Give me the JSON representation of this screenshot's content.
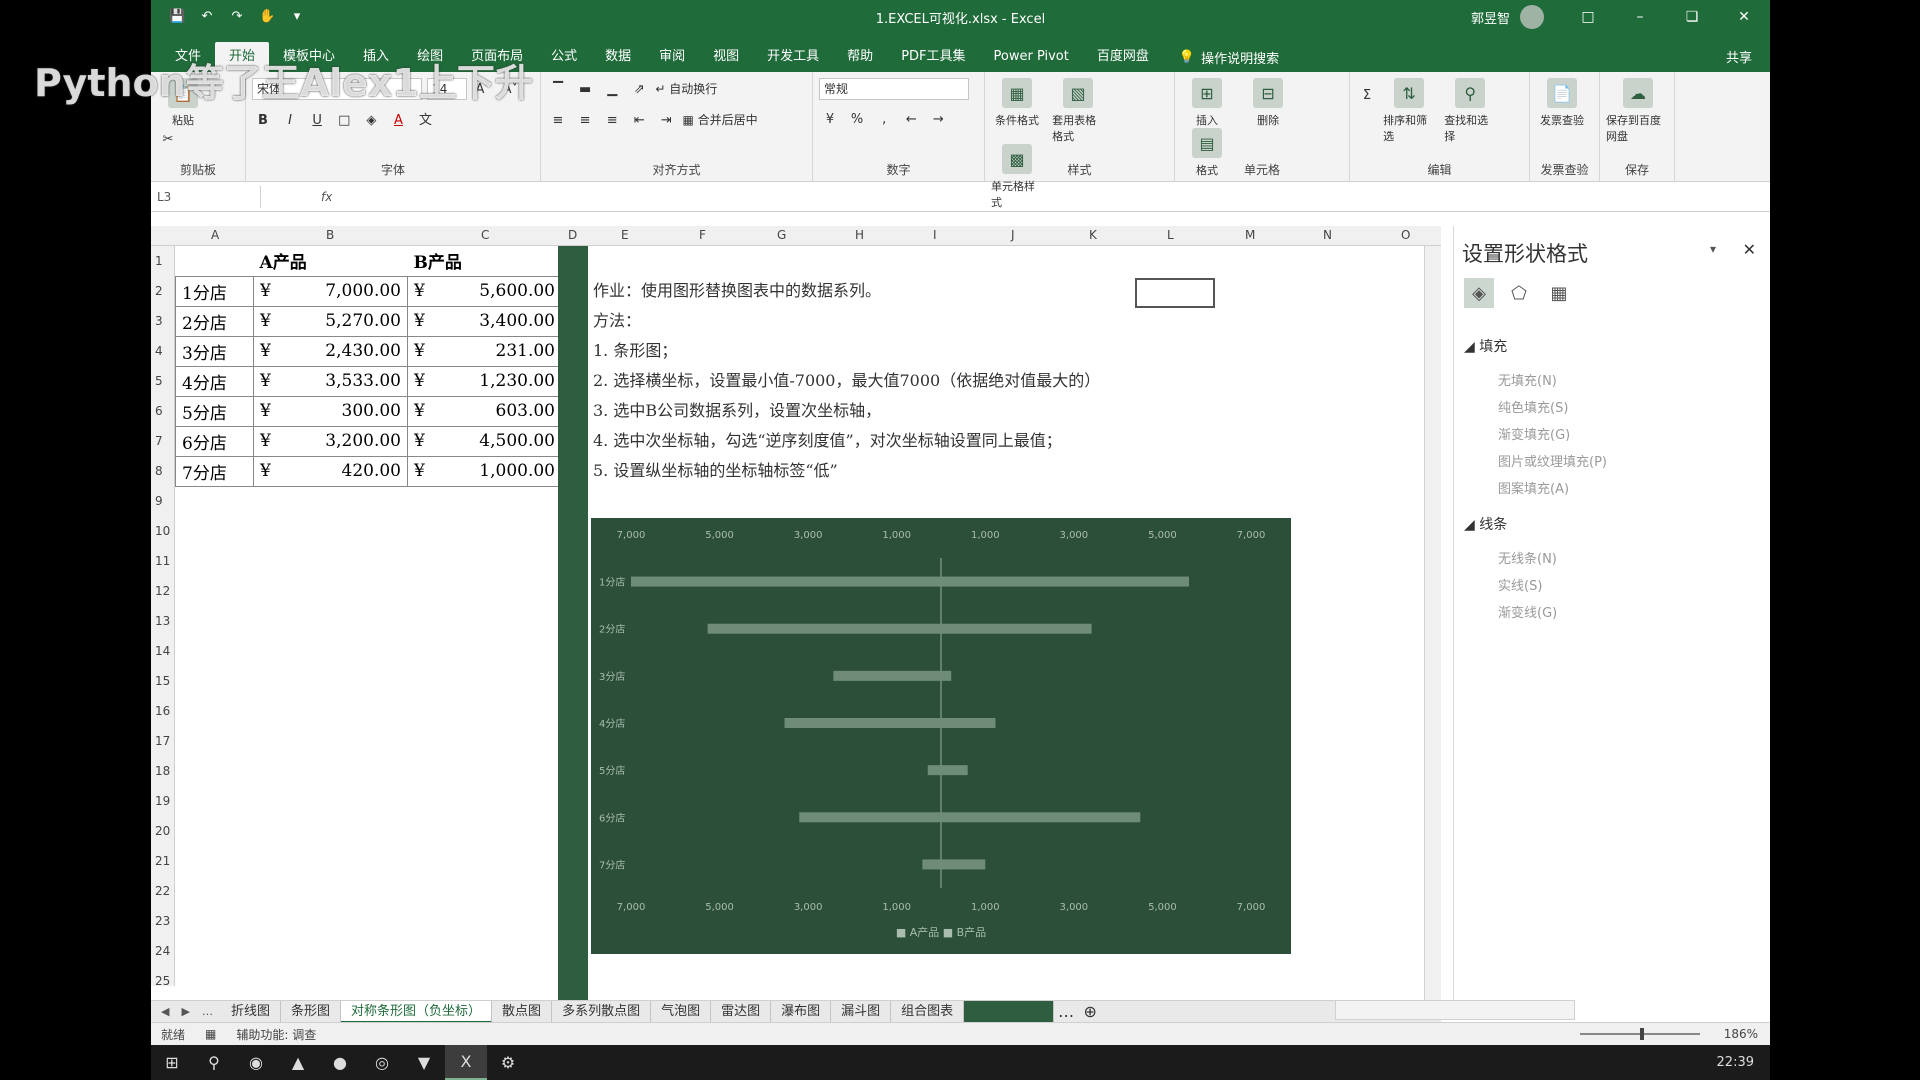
{
  "watermark": "Python等了王Alex1上下升",
  "window": {
    "title": "1.EXCEL可视化.xlsx - Excel",
    "user": "郭昱智",
    "buttons": [
      "□",
      "–",
      "❏",
      "✕"
    ]
  },
  "menu": {
    "tabs": [
      "文件",
      "开始",
      "模板中心",
      "插入",
      "绘图",
      "页面布局",
      "公式",
      "数据",
      "审阅",
      "视图",
      "开发工具",
      "帮助",
      "PDF工具集",
      "Power Pivot",
      "百度网盘"
    ],
    "tellme": "操作说明搜索",
    "share": "共享"
  },
  "ribbon": {
    "clipboard": "剪贴板",
    "paste": "粘贴",
    "font_group": "字体",
    "font_name": "宋体",
    "font_size": "14",
    "align_group": "对齐方式",
    "wrap": "自动换行",
    "merge": "合并后居中",
    "number_group": "数字",
    "number_format": "常规",
    "styles_group": "样式",
    "cond_format": "条件格式",
    "table_format": "套用表格格式",
    "cell_style": "单元格样式",
    "cells_group": "单元格",
    "insert": "插入",
    "delete": "删除",
    "format": "格式",
    "edit_group": "编辑",
    "sort": "排序和筛选",
    "find": "查找和选择",
    "invoice_group": "发票查验",
    "invoice": "发票查验",
    "save_group": "保存",
    "save_baidu": "保存到百度网盘"
  },
  "formula": {
    "namebox": "L3",
    "fx": "fx"
  },
  "columns": [
    "A",
    "B",
    "C",
    "D",
    "E",
    "F",
    "G",
    "H",
    "I",
    "J",
    "K",
    "L",
    "M",
    "N",
    "O"
  ],
  "rows": [
    "1",
    "2",
    "3",
    "4",
    "5",
    "6",
    "7",
    "8",
    "9",
    "10",
    "11",
    "12",
    "13",
    "14",
    "15",
    "16",
    "17",
    "18",
    "19",
    "20",
    "21",
    "22",
    "23",
    "24",
    "25"
  ],
  "table": {
    "headers": [
      "A产品",
      "B产品"
    ],
    "currency": "¥",
    "rows": [
      {
        "name": "1分店",
        "a": "7,000.00",
        "b": "5,600.00"
      },
      {
        "name": "2分店",
        "a": "5,270.00",
        "b": "3,400.00"
      },
      {
        "name": "3分店",
        "a": "2,430.00",
        "b": "231.00"
      },
      {
        "name": "4分店",
        "a": "3,533.00",
        "b": "1,230.00"
      },
      {
        "name": "5分店",
        "a": "300.00",
        "b": "603.00"
      },
      {
        "name": "6分店",
        "a": "3,200.00",
        "b": "4,500.00"
      },
      {
        "name": "7分店",
        "a": "420.00",
        "b": "1,000.00"
      }
    ]
  },
  "notes": [
    "作业：使用图形替换图表中的数据系列。",
    "方法：",
    "1. 条形图；",
    "2. 选择横坐标，设置最小值-7000，最大值7000（依据绝对值最大的）",
    "3. 选中B公司数据系列，设置次坐标轴，",
    "4. 选中次坐标轴，勾选“逆序刻度值”，对次坐标轴设置同上最值；",
    "5. 设置纵坐标轴的坐标轴标签“低”"
  ],
  "chart_data": {
    "type": "bar",
    "categories": [
      "1分店",
      "2分店",
      "3分店",
      "4分店",
      "5分店",
      "6分店",
      "7分店"
    ],
    "series": [
      {
        "name": "A产品",
        "values": [
          -7000,
          -5270,
          -2430,
          -3533,
          -300,
          -3200,
          -420
        ]
      },
      {
        "name": "B产品",
        "values": [
          5600,
          3400,
          231,
          1230,
          603,
          4500,
          1000
        ]
      }
    ],
    "xlim": [
      -7000,
      7000
    ],
    "top_ticks": [
      "7,000",
      "5,000",
      "3,000",
      "1,000",
      "1,000",
      "3,000",
      "5,000",
      "7,000"
    ],
    "bottom_ticks": [
      "7,000",
      "5,000",
      "3,000",
      "1,000",
      "1,000",
      "3,000",
      "5,000",
      "7,000"
    ],
    "legend": [
      "A产品",
      "B产品"
    ],
    "legend_position": "bottom",
    "bar_color": "#6f8c78",
    "background": "#2c4f3a"
  },
  "pane": {
    "title": "设置形状格式",
    "fill_section": "填充",
    "fill_options": [
      "无填充(N)",
      "纯色填充(S)",
      "渐变填充(G)",
      "图片或纹理填充(P)",
      "图案填充(A)"
    ],
    "line_section": "线条",
    "line_options": [
      "无线条(N)",
      "实线(S)",
      "渐变线(G)"
    ]
  },
  "sheets": [
    "折线图",
    "条形图",
    "对称条形图（负坐标）",
    "散点图",
    "多系列散点图",
    "气泡图",
    "雷达图",
    "瀑布图",
    "漏斗图",
    "组合图表"
  ],
  "status": {
    "ready": "就绪",
    "accessibility": "辅助功能: 调查",
    "zoom": "186%"
  },
  "taskbar": {
    "clock": "22:39"
  }
}
